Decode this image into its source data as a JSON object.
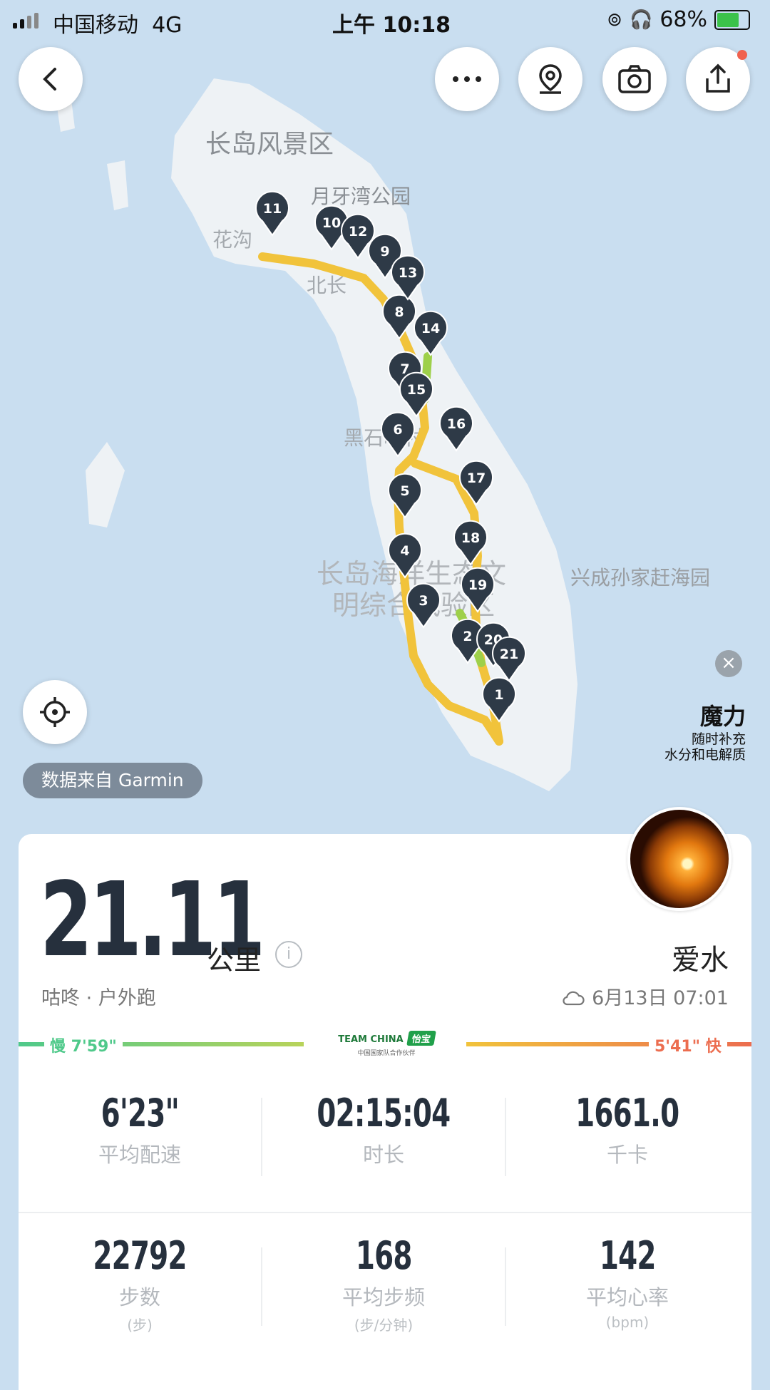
{
  "status": {
    "carrier": "中国移动",
    "network": "4G",
    "time": "上午 10:18",
    "battery": "68%"
  },
  "map": {
    "labels": {
      "scenic": "长岛风景区",
      "park": "月牙湾公园",
      "hua": "花沟",
      "bei": "北长",
      "heishi": "黑石嘴村",
      "zone1": "长岛海洋生态文",
      "zone2": "明综合试验区",
      "xingcheng": "兴成孙家赶海园"
    },
    "markers": [
      "1",
      "2",
      "3",
      "4",
      "5",
      "6",
      "7",
      "8",
      "9",
      "10",
      "11",
      "12",
      "13",
      "14",
      "15",
      "16",
      "17",
      "18",
      "19",
      "20",
      "21"
    ],
    "route_color": "#f1c33b",
    "route_fast_color": "#9ed04a"
  },
  "buttons": {
    "back": "back",
    "more": "more",
    "route": "route",
    "camera": "camera",
    "share": "share",
    "locate": "locate"
  },
  "data_source": "数据来自 Garmin",
  "ad": {
    "title": "魔力",
    "line1": "随时补充",
    "line2": "水分和电解质"
  },
  "summary": {
    "distance": "21.11",
    "unit": "公里",
    "subtitle": "咕咚 · 户外跑",
    "username": "爱水",
    "date": "6月13日 07:01"
  },
  "pace": {
    "slow": "慢 7'59\"",
    "fast": "5'41\" 快",
    "slow_color": "#4fc98a",
    "fast_color": "#ec6d4f"
  },
  "sponsor": {
    "name": "TEAM CHINA",
    "brand": "怡宝",
    "caption": "中国国家队合作伙伴"
  },
  "stats": [
    {
      "value": "6'23\"",
      "label": "平均配速",
      "unit": ""
    },
    {
      "value": "02:15:04",
      "label": "时长",
      "unit": ""
    },
    {
      "value": "1661.0",
      "label": "千卡",
      "unit": ""
    },
    {
      "value": "22792",
      "label": "步数",
      "unit": "(步)"
    },
    {
      "value": "168",
      "label": "平均步频",
      "unit": "(步/分钟)"
    },
    {
      "value": "142",
      "label": "平均心率",
      "unit": "(bpm)"
    }
  ]
}
